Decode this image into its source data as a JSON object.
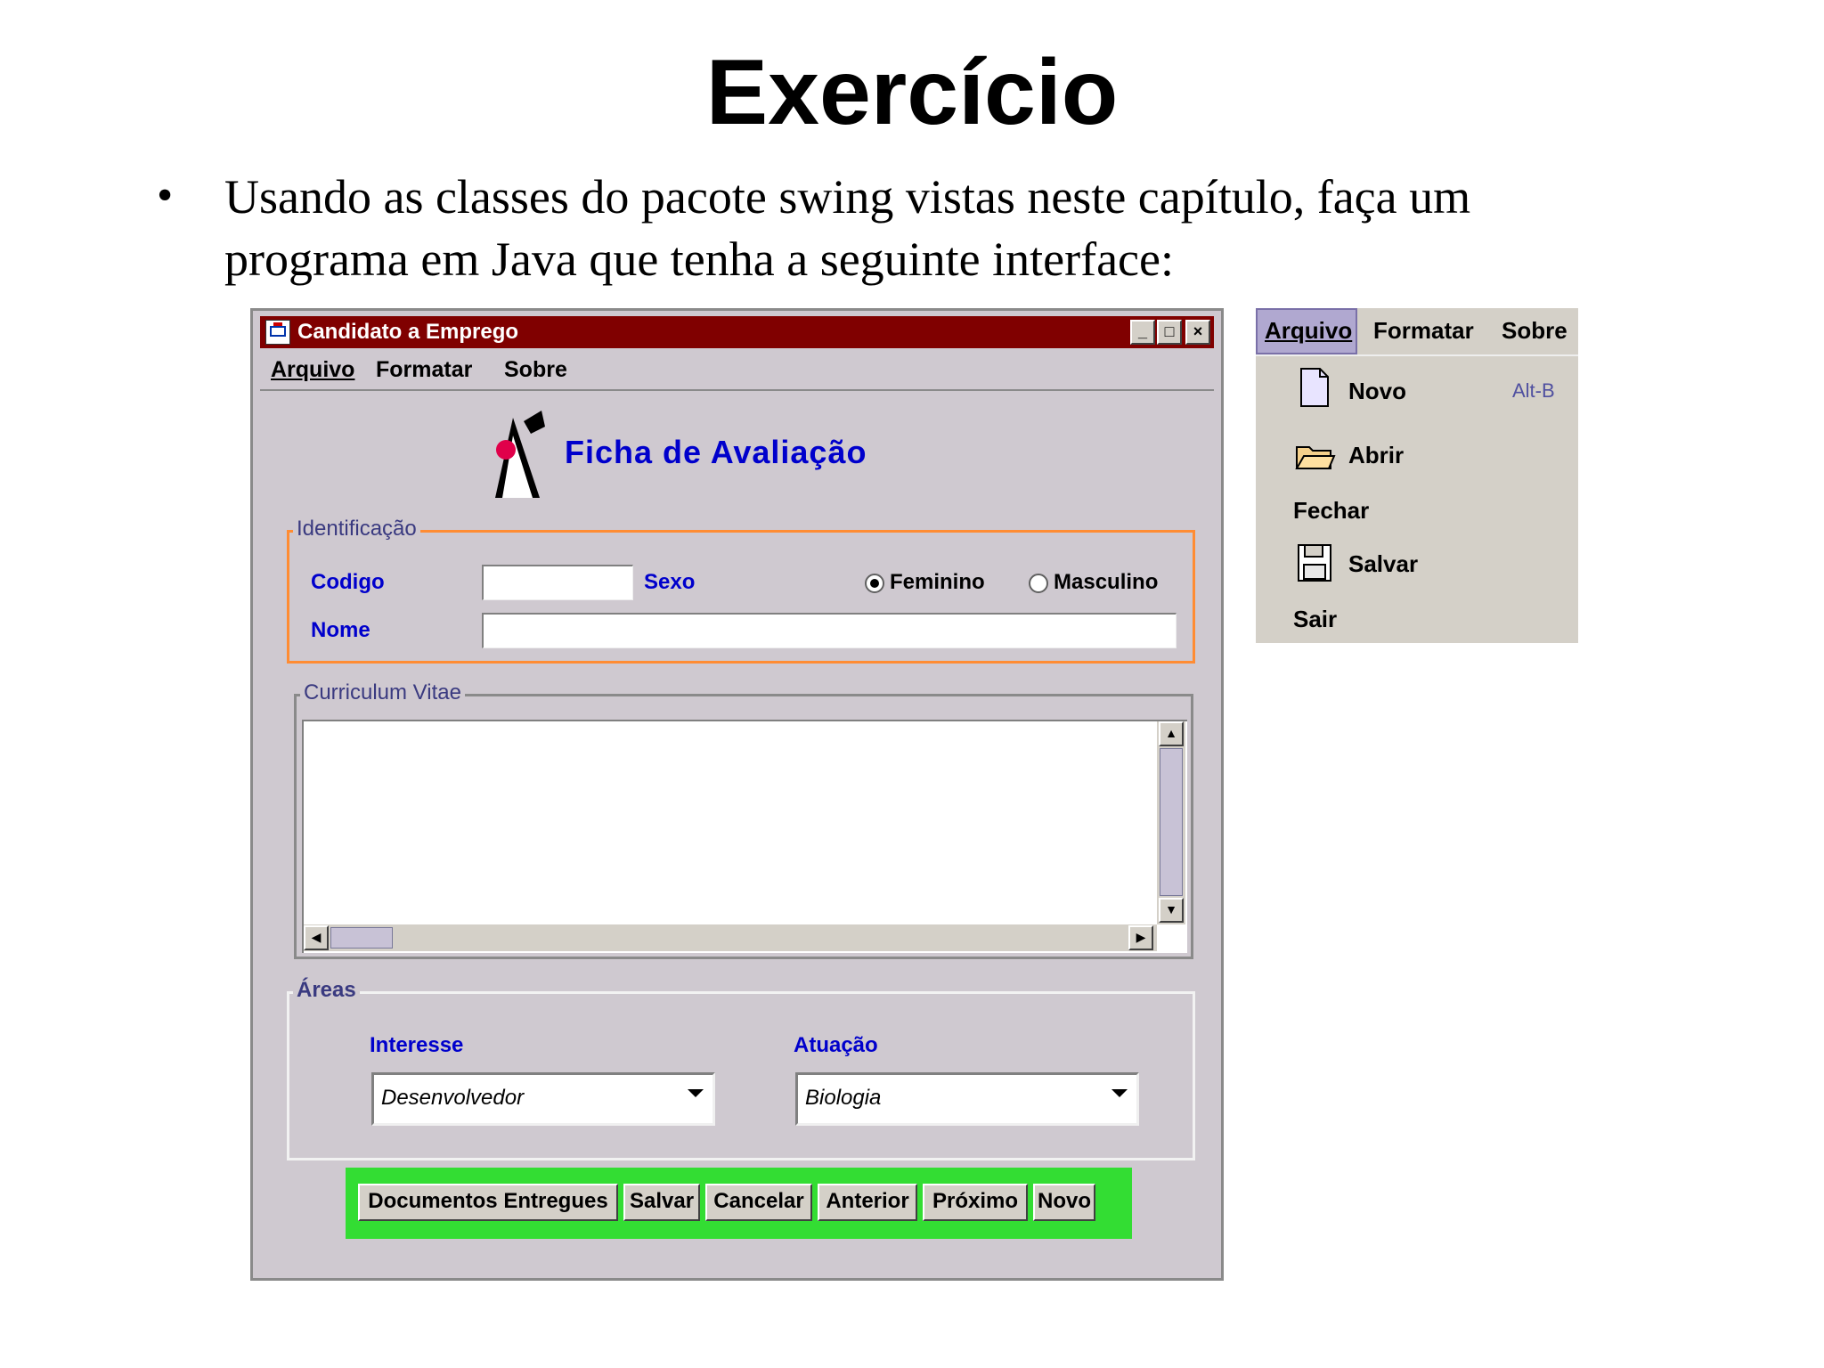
{
  "slide": {
    "title": "Exercício",
    "bullet": "•",
    "text": "Usando as classes do pacote swing vistas neste capítulo, faça um programa em Java que tenha a seguinte interface:"
  },
  "window": {
    "title": "Candidato a Emprego",
    "controls": {
      "minimize": "_",
      "maximize": "□",
      "close": "×"
    },
    "menu": [
      "Arquivo",
      "Formatar",
      "Sobre"
    ],
    "heading": "Ficha de Avaliação",
    "identificacao": {
      "label": "Identificação",
      "codigo_label": "Codigo",
      "codigo_value": "",
      "sexo_label": "Sexo",
      "radio_feminino": "Feminino",
      "radio_masculino": "Masculino",
      "selected": "Feminino",
      "nome_label": "Nome",
      "nome_value": ""
    },
    "curriculum": {
      "label": "Curriculum Vitae",
      "value": ""
    },
    "areas": {
      "label": "Áreas",
      "interesse_label": "Interesse",
      "interesse_value": "Desenvolvedor",
      "atuacao_label": "Atuação",
      "atuacao_value": "Biologia"
    },
    "buttons": [
      "Documentos Entregues",
      "Salvar",
      "Cancelar",
      "Anterior",
      "Próximo",
      "Novo"
    ]
  },
  "menu_panel": {
    "bar": [
      "Arquivo",
      "Formatar",
      "Sobre"
    ],
    "items": [
      {
        "label": "Novo",
        "shortcut": "Alt-B",
        "icon": "new-document-icon"
      },
      {
        "label": "Abrir",
        "shortcut": "",
        "icon": "open-folder-icon"
      },
      {
        "label": "Fechar",
        "shortcut": "",
        "icon": ""
      },
      {
        "label": "Salvar",
        "shortcut": "",
        "icon": "floppy-disk-icon"
      },
      {
        "label": "Sair",
        "shortcut": "",
        "icon": ""
      }
    ]
  },
  "colors": {
    "titlebar": "#800000",
    "window_bg": "#cfc9d0",
    "label_blue": "#0000cc",
    "identificacao_border": "#ff8c33",
    "button_bar": "#33dd33"
  }
}
